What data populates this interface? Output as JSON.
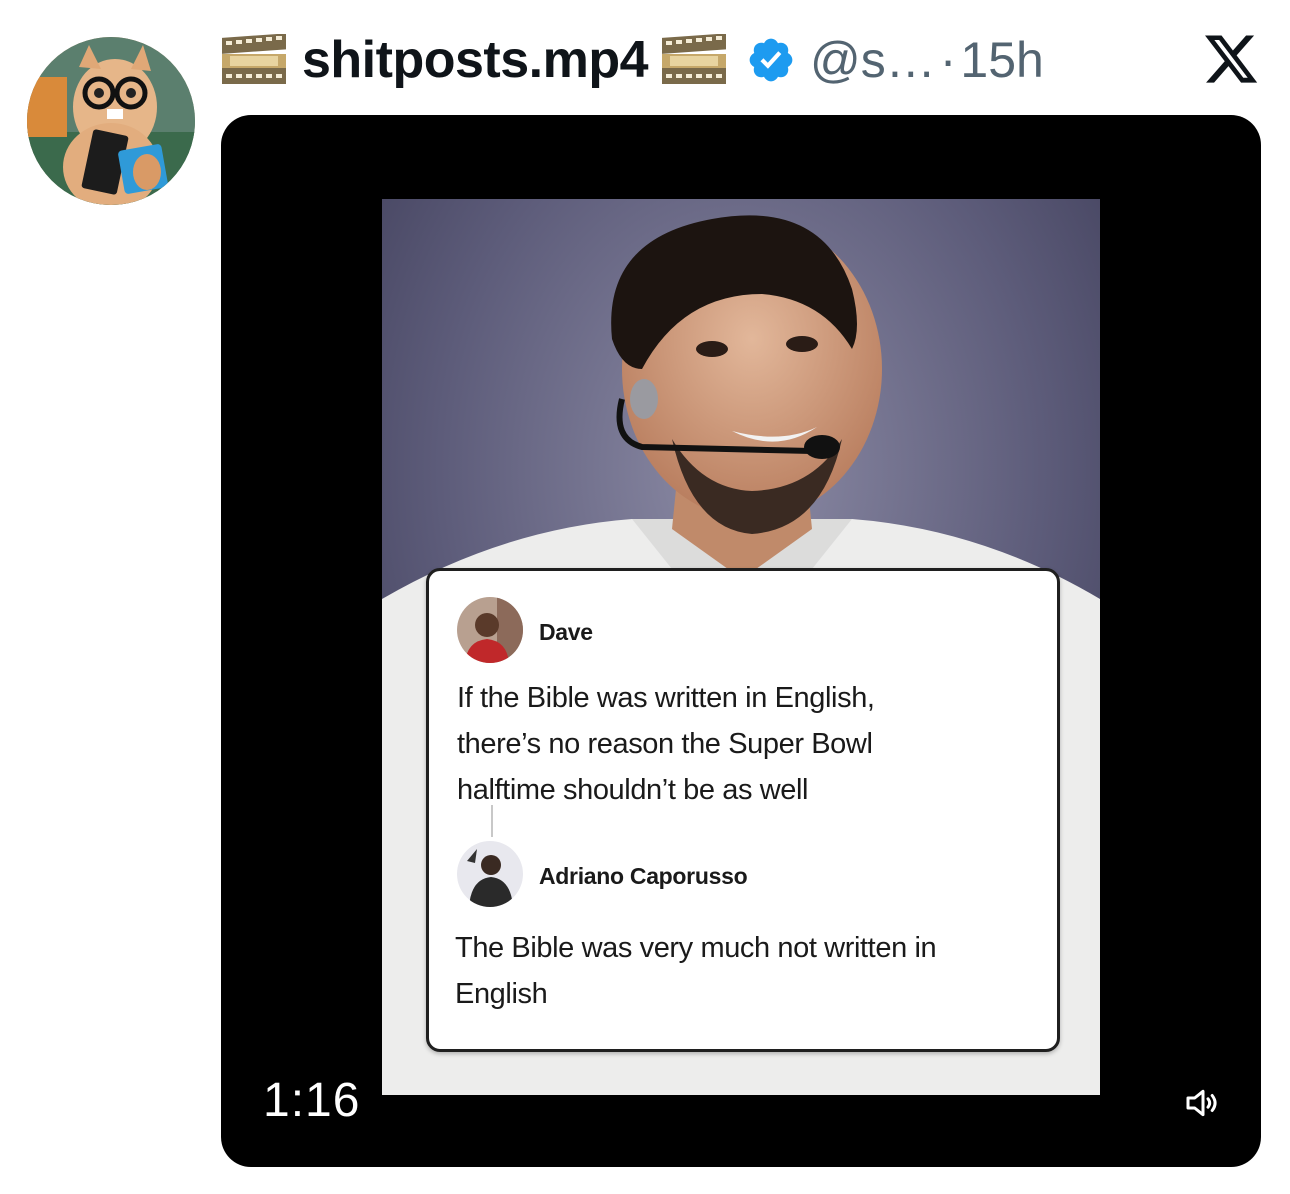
{
  "author": {
    "display_name": "shitposts.mp4",
    "handle": "@s…",
    "separator": "·",
    "time": "15h",
    "emoji_icon": "film-frames-icon",
    "verified_icon": "verified-badge-icon",
    "verified_color": "#1d9bf0"
  },
  "platform_icon": "x-logo-icon",
  "video": {
    "duration": "1:16",
    "volume_icon": "speaker-icon"
  },
  "meme": {
    "post": {
      "name": "Dave",
      "text_lines": [
        "If the Bible was written in English,",
        "there’s no reason the Super Bowl",
        "halftime shouldn’t be as well"
      ]
    },
    "reply": {
      "name": "Adriano Caporusso",
      "text_lines": [
        "The Bible was very much not written in",
        "English"
      ]
    }
  },
  "colors": {
    "text_primary": "#0f1419",
    "text_secondary": "#536471",
    "media_background": "#000000"
  }
}
